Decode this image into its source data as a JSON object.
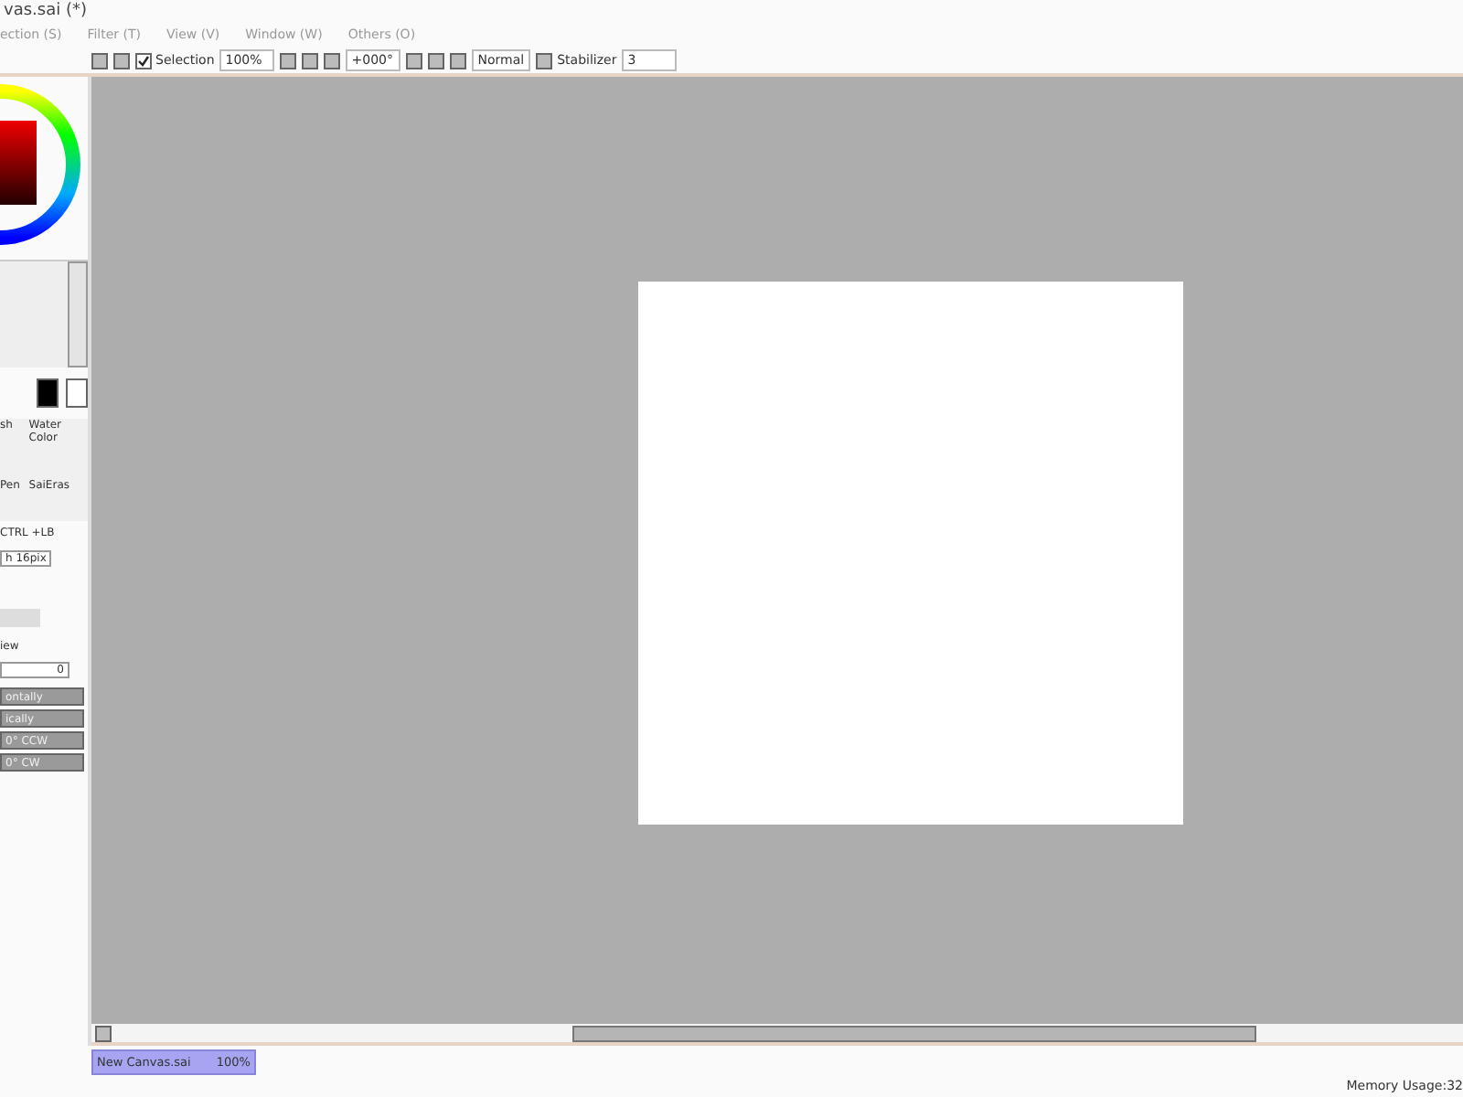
{
  "window": {
    "title": "vas.sai (*)"
  },
  "menu": [
    "ection (S)",
    "Filter (T)",
    "View (V)",
    "Window (W)",
    "Others (O)"
  ],
  "toolbar": {
    "selection": {
      "label": "Selection",
      "checked": true
    },
    "zoom": "100%",
    "angle": "+000°",
    "blend": "Normal",
    "stabilizer_label": "Stabilizer",
    "stabilizer": "3"
  },
  "tools": [
    {
      "label": "sh"
    },
    {
      "label": "Water Color"
    },
    {
      "label": "Pen"
    },
    {
      "label": "SaiEras"
    }
  ],
  "panel": {
    "shortcut": "CTRL +LB",
    "size": "h 16pix",
    "view_label": "iew",
    "view_value": "0",
    "buttons": [
      "ontally",
      "ically",
      "0° CCW",
      "0° CW"
    ]
  },
  "doc_tabs": [
    {
      "name": "New Canvas.sai",
      "zoom": "100%",
      "selected": true
    }
  ],
  "status_bar": "Memory Usage:32"
}
